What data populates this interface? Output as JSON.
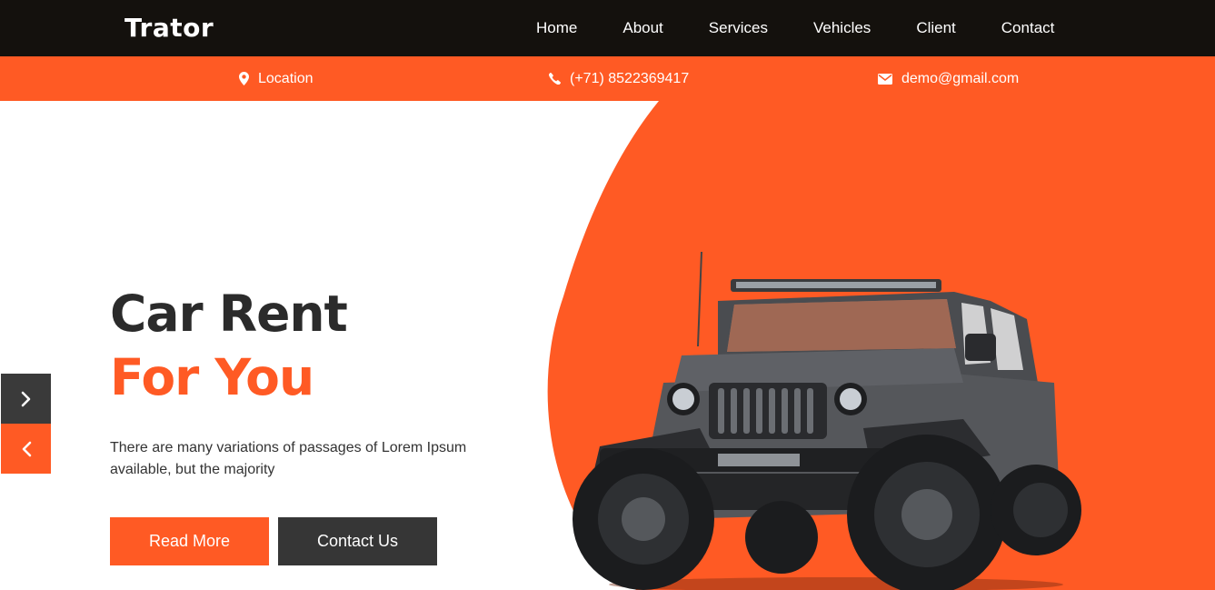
{
  "brand": {
    "name": "Trator"
  },
  "nav": {
    "items": [
      {
        "label": "Home"
      },
      {
        "label": "About"
      },
      {
        "label": "Services"
      },
      {
        "label": "Vehicles"
      },
      {
        "label": "Client"
      },
      {
        "label": "Contact"
      }
    ]
  },
  "contact_bar": {
    "location": {
      "icon": "map-marker-icon",
      "text": "Location"
    },
    "phone": {
      "icon": "phone-icon",
      "text": "(+71) 8522369417"
    },
    "email": {
      "icon": "envelope-icon",
      "text": "demo@gmail.com"
    }
  },
  "hero": {
    "title_line1": "Car Rent",
    "title_line2": "For You",
    "description": "There are many variations of passages of Lorem Ipsum available, but the majority",
    "read_more_label": "Read More",
    "contact_label": "Contact Us",
    "next_icon": "chevron-right-icon",
    "prev_icon": "chevron-left-icon"
  },
  "colors": {
    "accent": "#ff5a24",
    "topbar": "#14110d",
    "dark_button": "#363636",
    "heading": "#2b2b2b"
  }
}
